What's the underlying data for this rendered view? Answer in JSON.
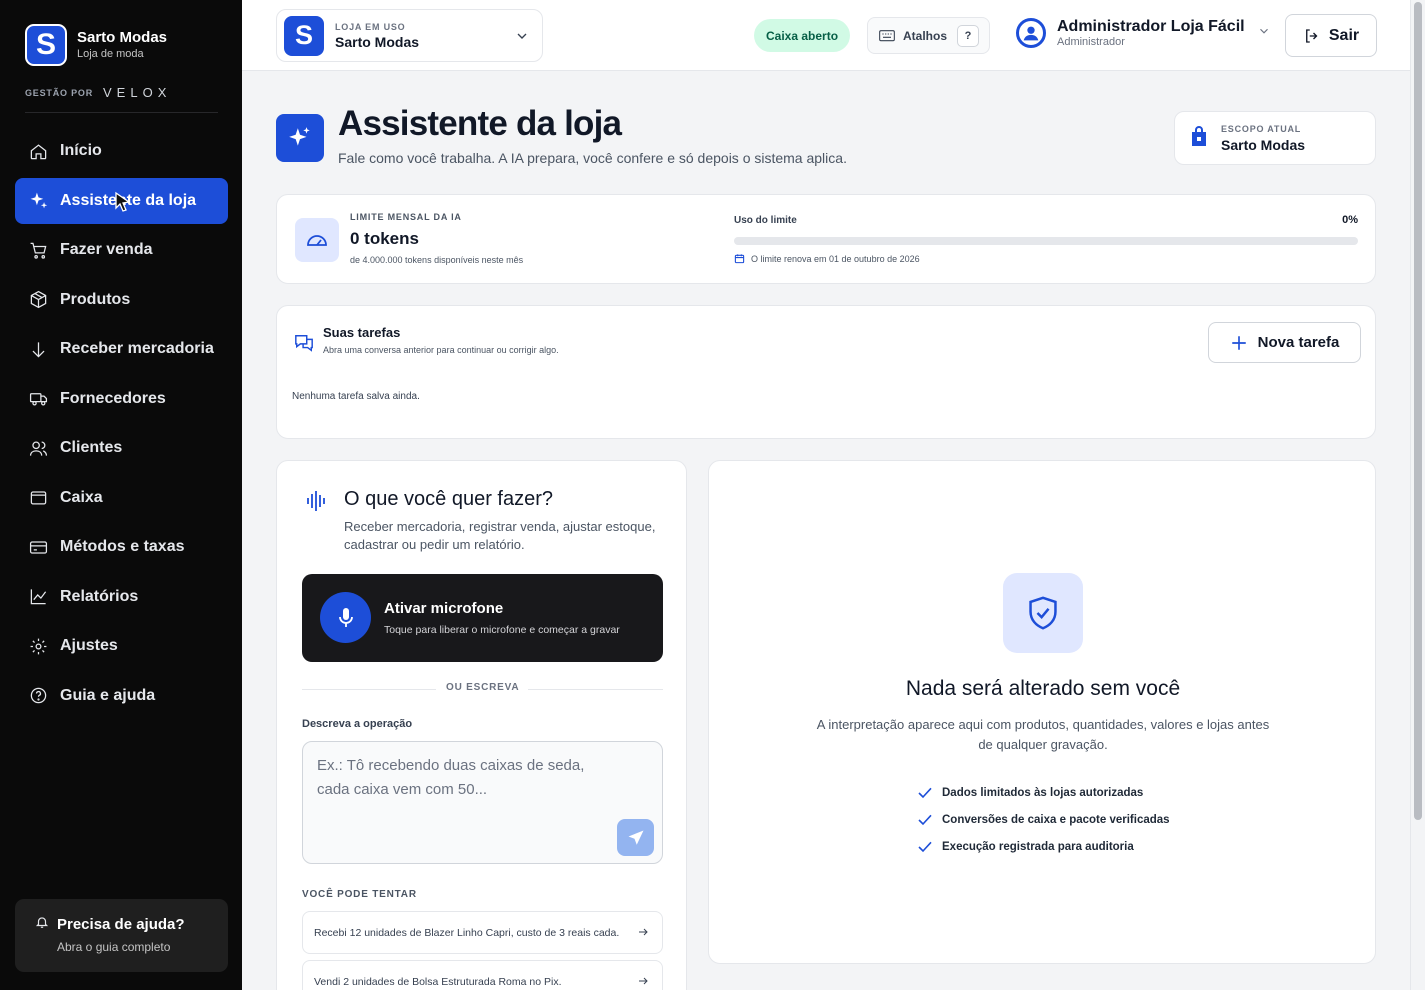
{
  "brand": {
    "logo": "S",
    "name": "Sarto Modas",
    "subtitle": "Loja de moda",
    "powered_label": "GESTÃO POR",
    "powered_brand": "VELOX"
  },
  "nav": {
    "items": [
      {
        "label": "Início",
        "icon": "home-icon"
      },
      {
        "label": "Assistente da loja",
        "icon": "sparkle-icon",
        "active": true
      },
      {
        "label": "Fazer venda",
        "icon": "cart-icon"
      },
      {
        "label": "Produtos",
        "icon": "box-icon"
      },
      {
        "label": "Receber mercadoria",
        "icon": "arrow-down-icon"
      },
      {
        "label": "Fornecedores",
        "icon": "truck-icon"
      },
      {
        "label": "Clientes",
        "icon": "users-icon"
      },
      {
        "label": "Caixa",
        "icon": "wallet-icon"
      },
      {
        "label": "Métodos e taxas",
        "icon": "credit-card-icon"
      },
      {
        "label": "Relatórios",
        "icon": "chart-icon"
      },
      {
        "label": "Ajustes",
        "icon": "gear-icon"
      },
      {
        "label": "Guia e ajuda",
        "icon": "help-icon"
      }
    ]
  },
  "help_card": {
    "title": "Precisa de ajuda?",
    "subtitle": "Abra o guia completo"
  },
  "header": {
    "store_label": "LOJA EM USO",
    "store_name": "Sarto Modas",
    "store_logo": "S",
    "cash_status": "Caixa aberto",
    "shortcuts_label": "Atalhos",
    "shortcuts_key": "?",
    "user_name": "Administrador Loja Fácil",
    "user_role": "Administrador",
    "logout_label": "Sair"
  },
  "page": {
    "title": "Assistente da loja",
    "subtitle": "Fale como você trabalha. A IA prepara, você confere e só depois o sistema aplica.",
    "scope_label": "ESCOPO ATUAL",
    "scope_value": "Sarto Modas"
  },
  "limit": {
    "label": "LIMITE MENSAL DA IA",
    "value": "0 tokens",
    "subtitle": "de 4.000.000 tokens disponíveis neste mês",
    "usage_label": "Uso do limite",
    "usage_percent_text": "0%",
    "usage_fraction": 0,
    "renew_text": "O limite renova em 01 de outubro de 2026"
  },
  "tasks": {
    "title": "Suas tarefas",
    "subtitle": "Abra uma conversa anterior para continuar ou corrigir algo.",
    "new_label": "Nova tarefa",
    "empty_text": "Nenhuma tarefa salva ainda."
  },
  "composer": {
    "title": "O que você quer fazer?",
    "subtitle": "Receber mercadoria, registrar venda, ajustar estoque, cadastrar ou pedir um relatório.",
    "mic_title": "Ativar microfone",
    "mic_subtitle": "Toque para liberar o microfone e começar a gravar",
    "or_label": "OU ESCREVA",
    "desc_label": "Descreva a operação",
    "desc_placeholder": "Ex.: Tô recebendo duas caixas de seda, cada caixa vem com 50...",
    "try_label": "VOCÊ PODE TENTAR",
    "suggestions": [
      "Recebi 12 unidades de Blazer Linho Capri, custo de 3 reais cada.",
      "Vendi 2 unidades de Bolsa Estruturada Roma no Pix."
    ]
  },
  "preview": {
    "title": "Nada será alterado sem você",
    "subtitle": "A interpretação aparece aqui com produtos, quantidades, valores e lojas antes de qualquer gravação.",
    "checks": [
      "Dados limitados às lojas autorizadas",
      "Conversões de caixa e pacote verificadas",
      "Execução registrada para auditoria"
    ]
  },
  "colors": {
    "accent": "#1d4ed8",
    "sidebar": "#0a0a0a",
    "success_bg": "#d1fae5",
    "success_text": "#065f46"
  }
}
